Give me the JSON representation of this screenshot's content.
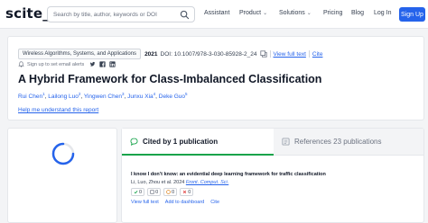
{
  "brand": {
    "logo": "scite_"
  },
  "search": {
    "placeholder": "Search by title, author, keywords or DOI"
  },
  "nav": {
    "assistant": "Assistant",
    "product": "Product",
    "solutions": "Solutions",
    "pricing": "Pricing",
    "blog": "Blog",
    "login": "Log In",
    "signup": "Sign Up"
  },
  "paper": {
    "journal": "Wireless Algorithms, Systems, and Applications",
    "year": "2021",
    "doi": "DOI: 10.1007/978-3-030-85928-2_24",
    "view_full_text": "View full text",
    "cite": "Cite",
    "alert": "Sign up to set email alerts",
    "title": "A Hybrid Framework for Class-Imbalanced Classification",
    "authors": [
      {
        "name": "Rui Chen",
        "sup": "1"
      },
      {
        "name": "Lailong Luo",
        "sup": "2"
      },
      {
        "name": "Yingwen Chen",
        "sup": "3"
      },
      {
        "name": "Junxu Xia",
        "sup": "4"
      },
      {
        "name": "Deke Guo",
        "sup": "5"
      }
    ],
    "help": "Help me understand this report"
  },
  "tabs": {
    "cited_by": "Cited by 1 publication",
    "references": "References 23 publications"
  },
  "citing": {
    "title": "I know I don't know: an evidential deep learning framework for traffic classification",
    "authors_year": "Li, Luo, Zhou et al. 2024",
    "journal": "Front. Comput. Sci.",
    "stats": {
      "supporting": "0",
      "mentioning": "0",
      "contrasting": "0",
      "citing": "0"
    },
    "view_full_text": "View full text",
    "add_dashboard": "Add to dashboard",
    "cite": "Cite"
  },
  "colors": {
    "accent": "#2563eb",
    "active_tab": "#16a34a",
    "spinner": "#2563eb"
  },
  "icons": [
    "search-icon",
    "chevron-down-icon",
    "copy-icon",
    "bell-icon",
    "twitter-icon",
    "facebook-icon",
    "linkedin-icon",
    "quote-icon",
    "references-icon"
  ]
}
